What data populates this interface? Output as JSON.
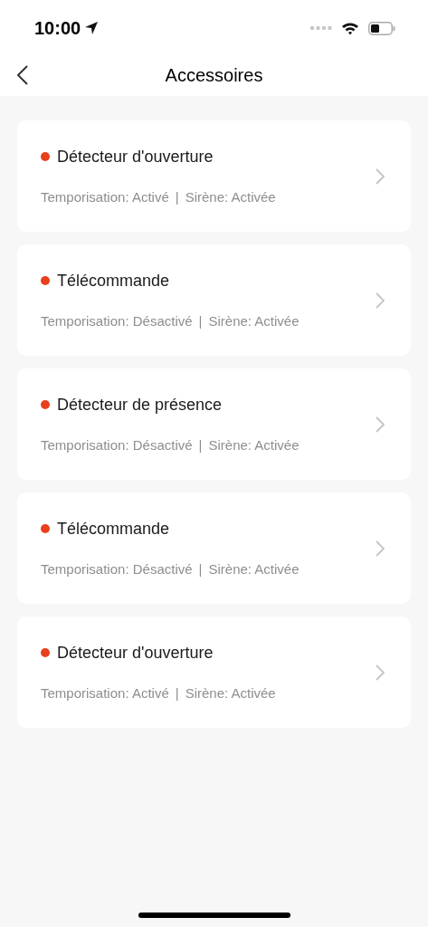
{
  "status_bar": {
    "time": "10:00"
  },
  "nav": {
    "title": "Accessoires"
  },
  "accessories": [
    {
      "name": "Détecteur d'ouverture",
      "color": "#e8401c",
      "delay": "Temporisation: Activé",
      "separator": "|",
      "siren": "Sirène: Activée"
    },
    {
      "name": "Télécommande",
      "color": "#e8401c",
      "delay": "Temporisation: Désactivé",
      "separator": "|",
      "siren": "Sirène: Activée"
    },
    {
      "name": "Détecteur de présence",
      "color": "#e8401c",
      "delay": "Temporisation: Désactivé",
      "separator": "|",
      "siren": "Sirène: Activée"
    },
    {
      "name": "Télécommande",
      "color": "#e8401c",
      "delay": "Temporisation: Désactivé",
      "separator": "|",
      "siren": "Sirène: Activée"
    },
    {
      "name": "Détecteur d'ouverture",
      "color": "#e8401c",
      "delay": "Temporisation: Activé",
      "separator": "|",
      "siren": "Sirène: Activée"
    }
  ]
}
